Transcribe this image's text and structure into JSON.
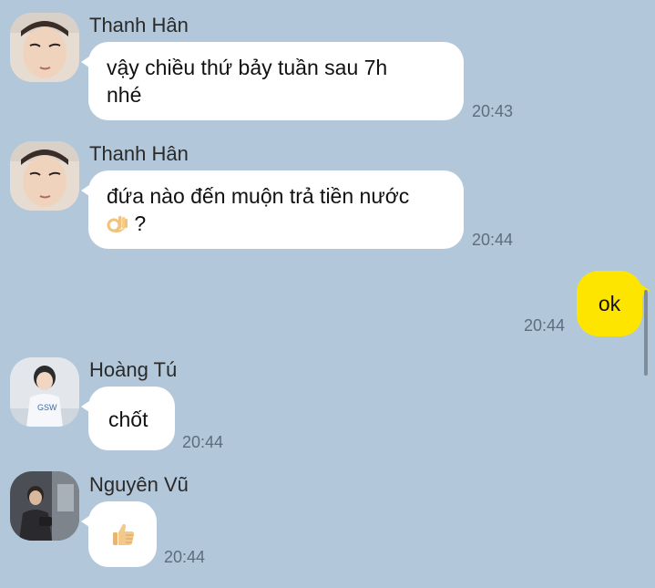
{
  "messages": [
    {
      "sender": "Thanh Hân",
      "lines": [
        "vậy chiều thứ bảy tuần sau 7h",
        "nhé"
      ],
      "time": "20:43"
    },
    {
      "sender": "Thanh Hân",
      "lines": [
        "đứa nào đến muộn trả tiền nước",
        "?"
      ],
      "emoji": "ok-hand-icon",
      "time": "20:44"
    },
    {
      "outgoing": true,
      "text": "ok",
      "time": "20:44"
    },
    {
      "sender": "Hoàng Tú",
      "text": "chốt",
      "time": "20:44"
    },
    {
      "sender": "Nguyên Vũ",
      "emoji": "thumbs-up-icon",
      "time": "20:44"
    }
  ],
  "colors": {
    "background": "#b2c7d9",
    "incoming_bubble": "#ffffff",
    "outgoing_bubble": "#fee500",
    "timestamp": "#5d6d7e"
  }
}
